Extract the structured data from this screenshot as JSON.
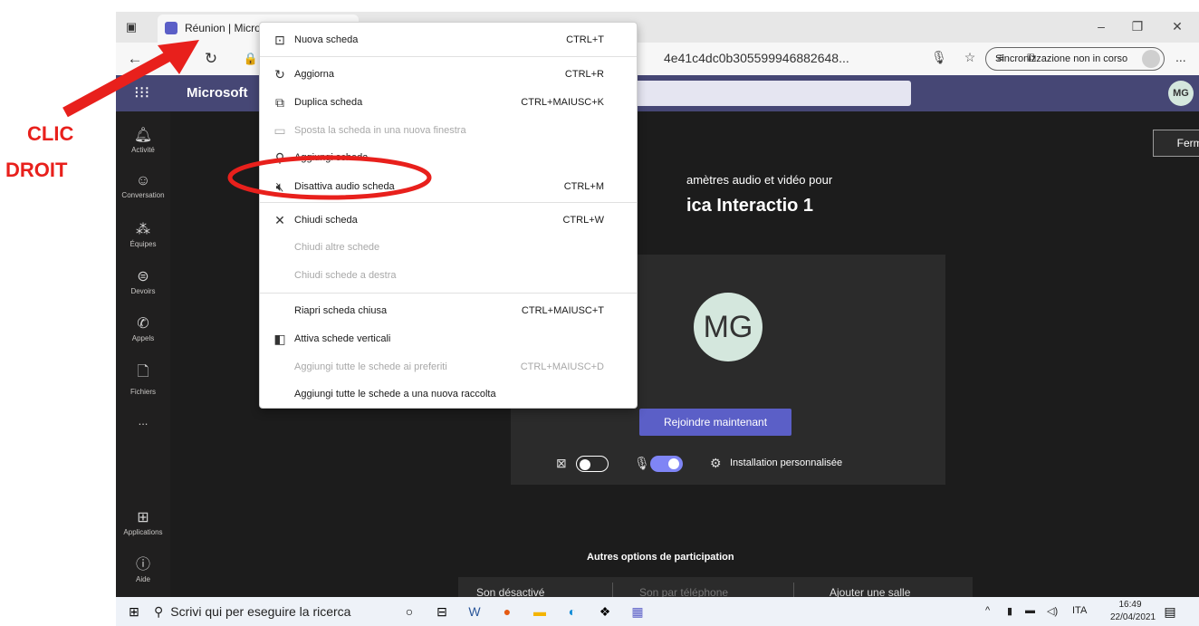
{
  "annotation": {
    "line1": "CLIC",
    "line2": "DROIT",
    "color": "#e8201c"
  },
  "browser": {
    "tab_title": "Réunion | Micros",
    "url_tail": "4e41c4dc0b305599946882648...",
    "sync_label": "Sincronizzazione non in corso",
    "more": "...",
    "icons": {
      "back": "back-arrow-icon",
      "refresh": "refresh-icon",
      "mic": "microphone-icon",
      "favorite": "add-favorite-icon",
      "favorites": "favorites-list-icon",
      "collections": "collections-icon"
    }
  },
  "teams": {
    "brand": "Microsoft",
    "avatar": "MG",
    "sidebar": [
      {
        "icon": "bell",
        "label": "Activité"
      },
      {
        "icon": "chat",
        "label": "Conversation"
      },
      {
        "icon": "teams",
        "label": "Équipes"
      },
      {
        "icon": "assignments",
        "label": "Devoirs"
      },
      {
        "icon": "phone",
        "label": "Appels"
      },
      {
        "icon": "file",
        "label": "Fichiers"
      },
      {
        "icon": "more",
        "label": "..."
      },
      {
        "icon": "apps",
        "label": "Applications"
      },
      {
        "icon": "help",
        "label": "Aide"
      }
    ],
    "close_label": "Fermer",
    "pre_title": "amètres audio et vidéo pour",
    "meeting_title": "ica Interactio 1",
    "big_avatar": "MG",
    "join_label": "Rejoindre maintenant",
    "camera_on": false,
    "mic_on": true,
    "setup_label": "Installation personnalisée",
    "other_options_title": "Autres options de participation",
    "other_options": [
      "Son désactivé",
      "Son par téléphone",
      "Ajouter une salle"
    ]
  },
  "context_menu": {
    "items": [
      {
        "icon": "new-tab",
        "label": "Nuova scheda",
        "shortcut": "CTRL+T",
        "disabled": false
      },
      {
        "icon": "refresh",
        "label": "Aggiorna",
        "shortcut": "CTRL+R",
        "disabled": false
      },
      {
        "icon": "duplicate",
        "label": "Duplica scheda",
        "shortcut": "CTRL+MAIUSC+K",
        "disabled": false
      },
      {
        "icon": "window",
        "label": "Sposta la scheda in una nuova finestra",
        "shortcut": "",
        "disabled": true
      },
      {
        "icon": "pin",
        "label": "Aggiungi scheda",
        "shortcut": "",
        "disabled": false
      },
      {
        "icon": "mute",
        "label": "Disattiva audio scheda",
        "shortcut": "CTRL+M",
        "disabled": false
      },
      {
        "icon": "close",
        "label": "Chiudi scheda",
        "shortcut": "CTRL+W",
        "disabled": false
      },
      {
        "icon": "",
        "label": "Chiudi altre schede",
        "shortcut": "",
        "disabled": true
      },
      {
        "icon": "",
        "label": "Chiudi schede a destra",
        "shortcut": "",
        "disabled": true
      },
      {
        "icon": "",
        "label": "Riapri scheda chiusa",
        "shortcut": "CTRL+MAIUSC+T",
        "disabled": false
      },
      {
        "icon": "vertical-tabs",
        "label": "Attiva schede verticali",
        "shortcut": "",
        "disabled": false
      },
      {
        "icon": "",
        "label": "Aggiungi tutte le schede ai preferiti",
        "shortcut": "CTRL+MAIUSC+D",
        "disabled": true
      },
      {
        "icon": "",
        "label": "Aggiungi tutte le schede a una nuova raccolta",
        "shortcut": "",
        "disabled": false
      }
    ]
  },
  "taskbar": {
    "search_placeholder": "Scrivi qui per eseguire la ricerca",
    "language": "ITA",
    "time": "16:49",
    "date": "22/04/2021"
  }
}
